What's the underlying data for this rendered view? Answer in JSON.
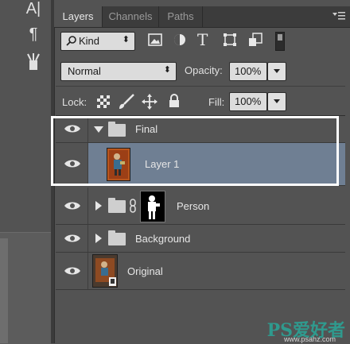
{
  "tabs": [
    {
      "label": "Layers",
      "active": true
    },
    {
      "label": "Channels",
      "active": false
    },
    {
      "label": "Paths",
      "active": false
    }
  ],
  "filter": {
    "kind_label": "Kind"
  },
  "blend": {
    "mode": "Normal",
    "opacity_label": "Opacity:",
    "opacity_value": "100%"
  },
  "lock": {
    "label": "Lock:",
    "fill_label": "Fill:",
    "fill_value": "100%"
  },
  "layers": [
    {
      "name": "Final",
      "type": "group",
      "expanded": true
    },
    {
      "name": "Layer 1",
      "type": "layer",
      "selected": true
    },
    {
      "name": "Person",
      "type": "group",
      "expanded": false
    },
    {
      "name": "Background",
      "type": "group",
      "expanded": false
    },
    {
      "name": "Original",
      "type": "smart-object"
    }
  ],
  "watermark": {
    "text": "PS爱好者",
    "url": "www.psahz.com"
  },
  "colors": {
    "panel": "#535353",
    "selected_row": "#6f7f93",
    "watermark": "#2f9a8e"
  }
}
